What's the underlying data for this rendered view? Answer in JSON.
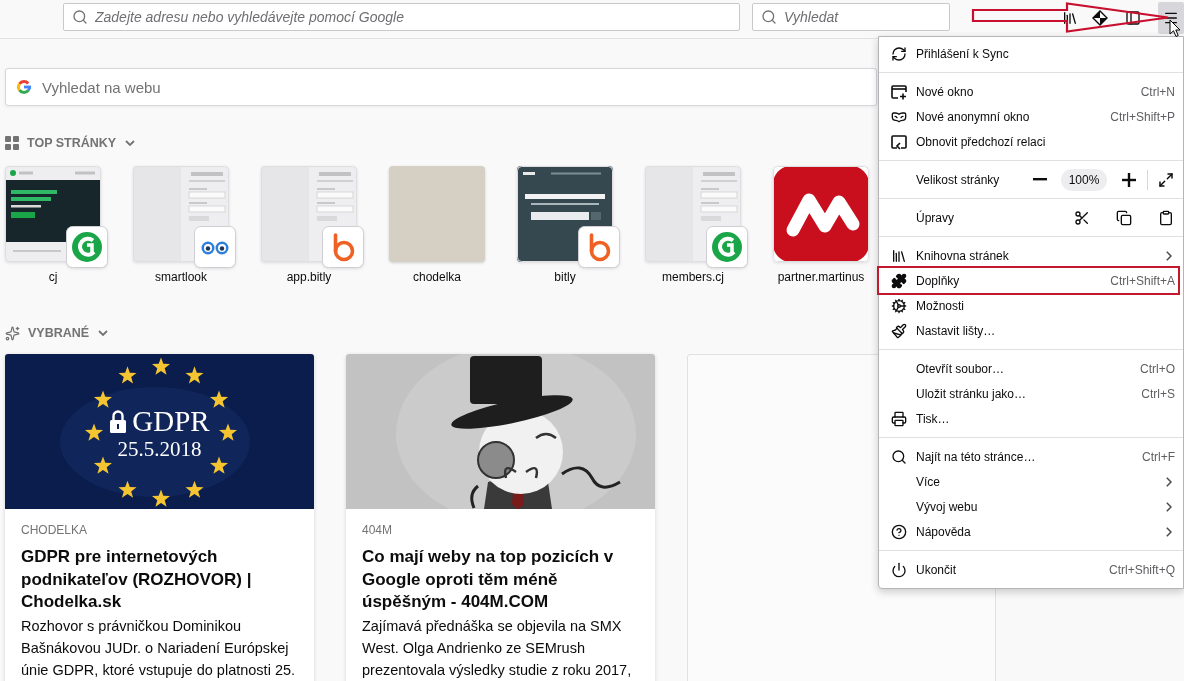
{
  "toolbar": {
    "address_field": {
      "placeholder": "Zadejte adresu nebo vyhledávejte pomocí Google"
    },
    "search_field": {
      "placeholder": "Vyhledat"
    },
    "menu_button": {
      "expanded": true,
      "annotated": true
    }
  },
  "page_search": {
    "placeholder": "Vyhledat na webu"
  },
  "top_sites": {
    "title": "TOP STRÁNKY",
    "expanded": true,
    "sites": [
      {
        "label": "cj",
        "kind": "dark",
        "badge": {
          "kind": "swirl"
        }
      },
      {
        "label": "smartlook",
        "kind": "form",
        "badge": {
          "kind": "eyes"
        }
      },
      {
        "label": "app.bitly",
        "kind": "form",
        "badge": {
          "kind": "ring"
        }
      },
      {
        "label": "chodelka",
        "kind": "photo"
      },
      {
        "label": "bitly",
        "kind": "banner",
        "badge": {
          "kind": "ring"
        }
      },
      {
        "label": "members.cj",
        "kind": "form",
        "badge": {
          "kind": "swirl"
        }
      },
      {
        "label": "partner.martinus",
        "kind": "logo"
      }
    ]
  },
  "highlights": {
    "title": "VYBRANÉ",
    "expanded": true,
    "cards": [
      {
        "kind": "article",
        "image": {
          "kind": "stars",
          "title": "GDPR",
          "subtitle": "25.5.2018"
        },
        "source": "CHODELKA",
        "title": "GDPR pre internetových podnikateľov (ROZHOVOR) | Chodelka.sk",
        "description": "Rozhovor s právničkou Dominikou Bašnákovou JUDr. o Nariadení Európskej únie GDPR, ktoré vstupuje do platnosti 25."
      },
      {
        "kind": "article",
        "image": {
          "kind": "cartoon"
        },
        "source": "404M",
        "title": "Co mají weby na top pozicích v Google oproti těm méně úspěšným - 404M.COM",
        "description": "Zajímavá přednáška se objevila na SMX West. Olga Andrienko ze SEMrush prezentovala výsledky studie z roku 2017,"
      },
      {
        "kind": "placeholder"
      }
    ]
  },
  "menu": {
    "sections": [
      {
        "items": [
          {
            "kind": "sync",
            "label": "Přihlášení k Sync",
            "submenu": false,
            "highlighted": false
          }
        ]
      },
      {
        "items": [
          {
            "kind": "window",
            "label": "Nové okno",
            "shortcut": "Ctrl+N",
            "submenu": false,
            "highlighted": false
          },
          {
            "kind": "private",
            "label": "Nové anonymní okno",
            "shortcut": "Ctrl+Shift+P",
            "submenu": false,
            "highlighted": false
          },
          {
            "kind": "restore",
            "label": "Obnovit předchozí relaci",
            "submenu": false,
            "highlighted": false
          }
        ]
      },
      {
        "items": [
          {
            "kind": "zoom",
            "label": "Velikost stránky",
            "value": "100%"
          }
        ]
      },
      {
        "items": [
          {
            "kind": "edit",
            "label": "Úpravy"
          }
        ]
      },
      {
        "items": [
          {
            "kind": "library",
            "label": "Knihovna stránek",
            "submenu": true,
            "highlighted": false
          },
          {
            "kind": "addons",
            "label": "Doplňky",
            "shortcut": "Ctrl+Shift+A",
            "submenu": false,
            "highlighted": true
          },
          {
            "kind": "options",
            "label": "Možnosti",
            "submenu": false,
            "highlighted": false
          },
          {
            "kind": "customize",
            "label": "Nastavit lišty…",
            "submenu": false,
            "highlighted": false
          }
        ]
      },
      {
        "items": [
          {
            "kind": "open",
            "label": "Otevřít soubor…",
            "shortcut": "Ctrl+O",
            "submenu": false,
            "highlighted": false
          },
          {
            "kind": "save",
            "label": "Uložit stránku jako…",
            "shortcut": "Ctrl+S",
            "submenu": false,
            "highlighted": false
          },
          {
            "kind": "print",
            "label": "Tisk…",
            "submenu": false,
            "highlighted": false
          }
        ]
      },
      {
        "items": [
          {
            "kind": "find",
            "label": "Najít na této stránce…",
            "shortcut": "Ctrl+F",
            "submenu": false,
            "highlighted": false
          },
          {
            "kind": "more",
            "label": "Více",
            "submenu": true,
            "highlighted": false
          },
          {
            "kind": "devtools",
            "label": "Vývoj webu",
            "submenu": true,
            "highlighted": false
          },
          {
            "kind": "help",
            "label": "Nápověda",
            "submenu": true,
            "highlighted": false
          }
        ]
      },
      {
        "items": [
          {
            "kind": "quit",
            "label": "Ukončit",
            "shortcut": "Ctrl+Shift+Q",
            "submenu": false,
            "highlighted": false
          }
        ]
      }
    ]
  }
}
